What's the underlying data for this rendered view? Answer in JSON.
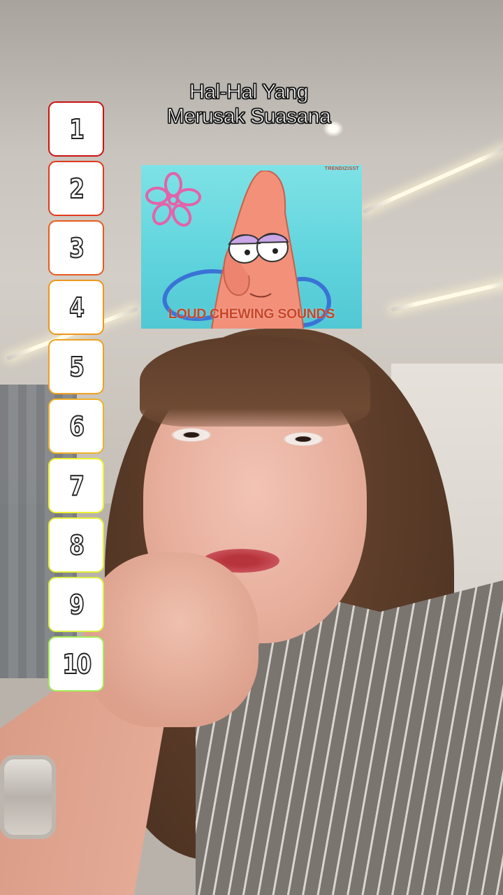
{
  "overlay": {
    "title_line1": "Hal-Hal Yang",
    "title_line2": "Merusak Suasana"
  },
  "ranking": {
    "items": [
      {
        "label": "1",
        "border": "#cc1212"
      },
      {
        "label": "2",
        "border": "#e03a1c"
      },
      {
        "label": "3",
        "border": "#e85a1e"
      },
      {
        "label": "4",
        "border": "#f0961c"
      },
      {
        "label": "5",
        "border": "#f0a020"
      },
      {
        "label": "6",
        "border": "#f0b02a"
      },
      {
        "label": "7",
        "border": "#eef030"
      },
      {
        "label": "8",
        "border": "#e6ee3a"
      },
      {
        "label": "9",
        "border": "#d9ee44"
      },
      {
        "label": "10",
        "border": "#a6ec58"
      }
    ]
  },
  "meme": {
    "watermark": "TRENDIZISST",
    "caption": "LOUD CHEWING SOUNDS"
  },
  "colors": {
    "title_text": "#ffffff",
    "caption_text": "#c84628",
    "meme_background": "#5fd3dc"
  }
}
